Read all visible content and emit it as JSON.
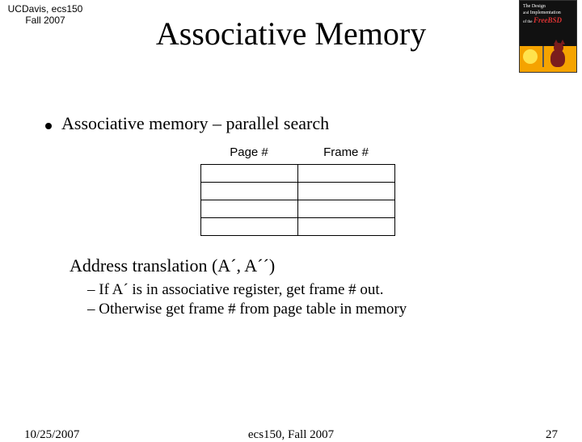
{
  "header": {
    "course_line1": "UCDavis, ecs150",
    "course_line2": "Fall 2007",
    "title": "Associative Memory"
  },
  "book": {
    "line1": "The Design",
    "line2": "Implementation",
    "bsd": "FreeBSD"
  },
  "bullet": {
    "text": "Associative memory – parallel search"
  },
  "table": {
    "col1": "Page #",
    "col2": "Frame #"
  },
  "translation": {
    "heading": "Address translation (A´, A´´)",
    "line1": "– If A´ is in associative register, get frame # out.",
    "line2": "– Otherwise get frame # from page table in memory"
  },
  "footer": {
    "date": "10/25/2007",
    "center": "ecs150, Fall 2007",
    "page": "27"
  }
}
